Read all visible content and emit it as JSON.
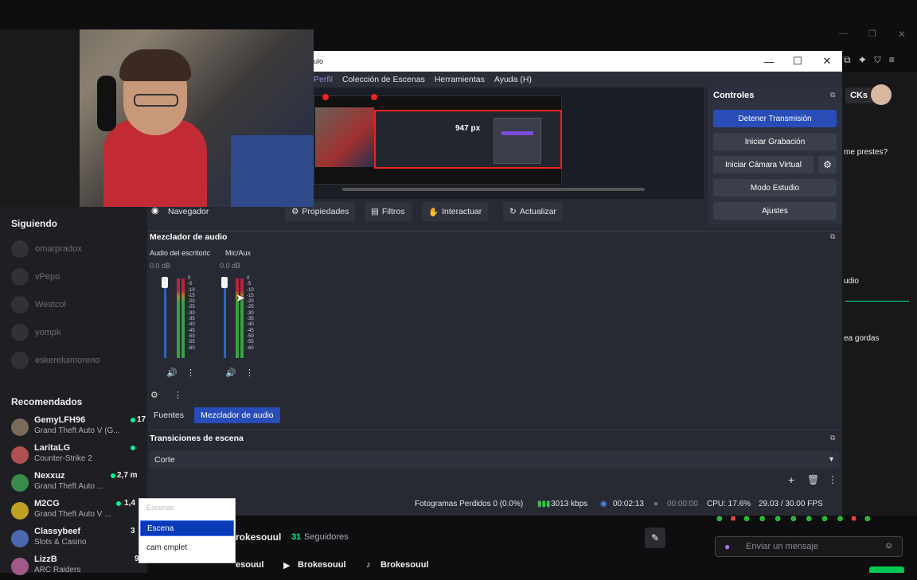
{
  "obs": {
    "title_fragment": "ulo",
    "menu": [
      "Perfil",
      "Colección de Escenas",
      "Herramientas",
      "Ayuda (H)"
    ],
    "preview_px": "947 px",
    "toolbar": {
      "navigator": "Navegador",
      "properties": "Propiedades",
      "filters": "Filtros",
      "interact": "Interactuar",
      "refresh": "Actualizar"
    },
    "controls": {
      "title": "Controles",
      "stop_stream": "Detener Transmisión",
      "start_recording": "Iniciar Grabación",
      "start_virtual_cam": "Iniciar Cámara Virtual",
      "studio_mode": "Modo Estudio",
      "settings": "Ajustes"
    },
    "mixer": {
      "title": "Mezclador de audio",
      "channels": [
        {
          "name": "Audio del escritoric",
          "db": "0.0 dB",
          "level": 1.0
        },
        {
          "name": "Mic/Aux",
          "db": "0.0 dB",
          "level": 1.0
        }
      ],
      "scale": [
        "0",
        "-5",
        "-10",
        "-15",
        "-20",
        "-25",
        "-30",
        "-35",
        "-40",
        "-45",
        "-50",
        "-55",
        "-60"
      ]
    },
    "tabs": [
      "Fuentes",
      "Mezclador de audio"
    ],
    "transitions": {
      "title": "Transiciones de escena",
      "selected": "Corte"
    },
    "status": {
      "dropped_frames": "Fotogramas Perdidos 0 (0.0%)",
      "bitrate": "3013 kbps",
      "stream_time": "00:02:13",
      "rec_time": "00:00:00",
      "cpu": "CPU: 17.6%",
      "fps": "29.03 / 30.00 FPS"
    },
    "scenes_dropdown": {
      "header": "Escenas",
      "items": [
        "Escena",
        "cam cmplet"
      ]
    }
  },
  "twitch": {
    "following_title": "Siguiendo",
    "following": [
      "omarpradox",
      "vPepo",
      "Westcol",
      "yompk",
      "eskereluimoreno"
    ],
    "recommended_title": "Recomendados",
    "recommended": [
      {
        "name": "GemyLFH96",
        "game": "Grand Theft Auto V (G...",
        "viewers": "17",
        "avatar": "#7a6a5a"
      },
      {
        "name": "LaritaLG",
        "game": "Counter-Strike 2",
        "viewers": "",
        "avatar": "#b05050"
      },
      {
        "name": "Nexxuz",
        "game": "Grand Theft Auto ...",
        "viewers": "2,7 m",
        "avatar": "#3a8a4a"
      },
      {
        "name": "M2CG",
        "game": "Grand Theft Auto V ...",
        "viewers": "1,4",
        "avatar": "#c0a020"
      },
      {
        "name": "Classybeef",
        "game": "Slots & Casino",
        "viewers": "3",
        "avatar": "#4a6ab0"
      },
      {
        "name": "LizzB",
        "game": "ARC Raiders",
        "viewers": "9",
        "avatar": "#a05a8a"
      }
    ],
    "channel": {
      "name_fragment": "rokesouul",
      "followers_count": "31",
      "followers_label": "Seguidores",
      "socials": [
        "esouul",
        "Brokesouul",
        "Brokesouul"
      ]
    },
    "chat": {
      "snippets": [
        "CKs",
        "me prestes?",
        "udio",
        "ea gordas"
      ],
      "placeholder": "Enviar un mensaje"
    }
  }
}
